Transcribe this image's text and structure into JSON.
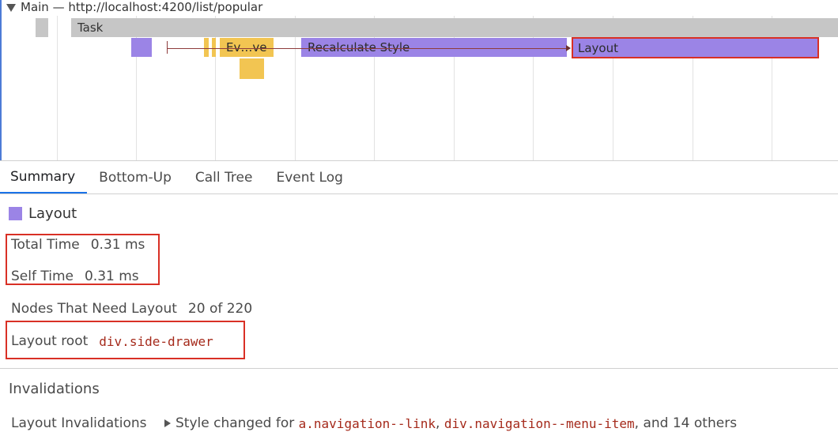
{
  "flame": {
    "track_title": "Main — http://localhost:4200/list/popular",
    "bars": {
      "task": "Task",
      "evaluate": "Ev…ve",
      "recalc": "Recalculate Style",
      "layout": "Layout"
    }
  },
  "tabs": [
    "Summary",
    "Bottom-Up",
    "Call Tree",
    "Event Log"
  ],
  "active_tab": "Summary",
  "summary": {
    "title": "Layout",
    "swatch_color": "#9b84e6",
    "total_time_label": "Total Time",
    "total_time_value": "0.31 ms",
    "self_time_label": "Self Time",
    "self_time_value": "0.31 ms",
    "nodes_label": "Nodes That Need Layout",
    "nodes_value": "20 of 220",
    "layout_root_label": "Layout root",
    "layout_root_value": "div.side-drawer"
  },
  "invalidations": {
    "section_title": "Invalidations",
    "row_label": "Layout Invalidations",
    "prefix": "Style changed for ",
    "selector1": "a.navigation--link",
    "sep": ", ",
    "selector2": "div.navigation--menu-item",
    "suffix": ", and 14 others"
  },
  "colors": {
    "accent": "#1a73e8",
    "highlight_box": "#d93025",
    "layout_purple": "#9b84e6",
    "script_yellow": "#f2c552",
    "task_gray": "#c6c6c6"
  }
}
